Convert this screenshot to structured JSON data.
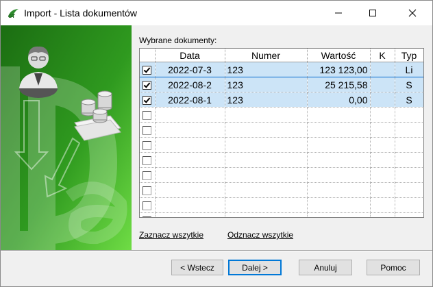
{
  "window": {
    "title": "Import - Lista dokumentów"
  },
  "grid": {
    "label": "Wybrane dokumenty:",
    "columns": [
      "",
      "Data",
      "Numer",
      "Wartość",
      "K",
      "Typ"
    ],
    "rows": [
      {
        "checked": true,
        "date": "2022-07-3",
        "number": "123",
        "value": "123 123,00",
        "k": "",
        "type": "Li"
      },
      {
        "checked": true,
        "date": "2022-08-2",
        "number": "123",
        "value": "25 215,58",
        "k": "",
        "type": "S"
      },
      {
        "checked": true,
        "date": "2022-08-1",
        "number": "123",
        "value": "0,00",
        "k": "",
        "type": "S"
      },
      {
        "checked": false,
        "date": "",
        "number": "",
        "value": "",
        "k": "",
        "type": ""
      },
      {
        "checked": false,
        "date": "",
        "number": "",
        "value": "",
        "k": "",
        "type": ""
      },
      {
        "checked": false,
        "date": "",
        "number": "",
        "value": "",
        "k": "",
        "type": ""
      },
      {
        "checked": false,
        "date": "",
        "number": "",
        "value": "",
        "k": "",
        "type": ""
      },
      {
        "checked": false,
        "date": "",
        "number": "",
        "value": "",
        "k": "",
        "type": ""
      },
      {
        "checked": false,
        "date": "",
        "number": "",
        "value": "",
        "k": "",
        "type": ""
      },
      {
        "checked": false,
        "date": "",
        "number": "",
        "value": "",
        "k": "",
        "type": ""
      },
      {
        "checked": false,
        "date": "",
        "number": "",
        "value": "",
        "k": "",
        "type": ""
      }
    ]
  },
  "links": {
    "select_all": "Zaznacz wszytkie",
    "deselect_all": "Odznacz wszytkie"
  },
  "buttons": {
    "back": "< Wstecz",
    "next": "Dalej >",
    "cancel": "Anuluj",
    "help": "Pomoc"
  },
  "colors": {
    "panel_green_dark": "#1e7a14",
    "panel_green_light": "#5fcf3c",
    "selection": "#cce4f7",
    "focus": "#0066cc"
  },
  "icons": {
    "app": "gt-logo-icon",
    "minimize": "minimize-icon",
    "maximize": "maximize-icon",
    "close": "close-icon",
    "user": "user-icon",
    "coins": "coins-icon"
  }
}
